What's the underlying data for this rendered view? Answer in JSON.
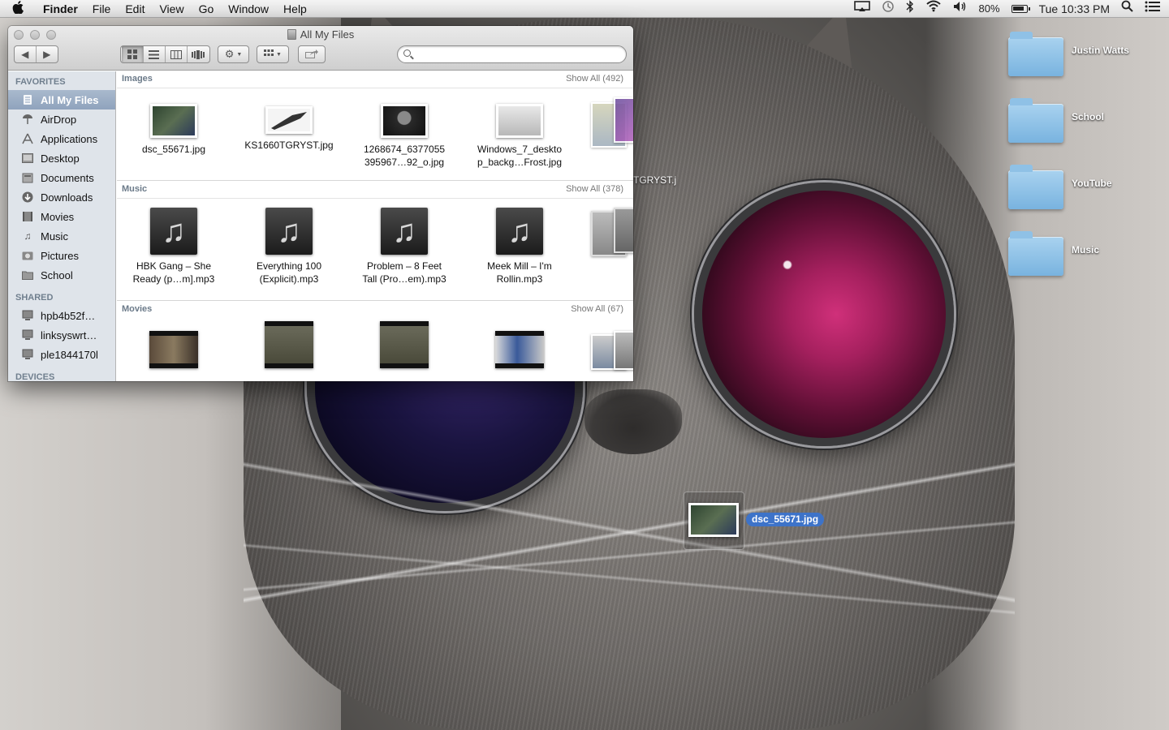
{
  "menubar": {
    "app_name": "Finder",
    "menus": [
      "File",
      "Edit",
      "View",
      "Go",
      "Window",
      "Help"
    ],
    "battery_percent": "80%",
    "clock": "Tue 10:33 PM",
    "status_icons": [
      "airplay-icon",
      "time-machine-icon",
      "bluetooth-icon",
      "wifi-icon",
      "volume-icon",
      "battery-icon",
      "spotlight-icon",
      "notification-center-icon"
    ]
  },
  "window": {
    "title": "All My Files"
  },
  "sidebar": {
    "favorites_header": "FAVORITES",
    "favorites": [
      {
        "label": "All My Files",
        "icon": "all-my-files-icon",
        "selected": true
      },
      {
        "label": "AirDrop",
        "icon": "airdrop-icon"
      },
      {
        "label": "Applications",
        "icon": "applications-icon"
      },
      {
        "label": "Desktop",
        "icon": "desktop-icon"
      },
      {
        "label": "Documents",
        "icon": "documents-icon"
      },
      {
        "label": "Downloads",
        "icon": "downloads-icon"
      },
      {
        "label": "Movies",
        "icon": "movies-icon"
      },
      {
        "label": "Music",
        "icon": "music-icon"
      },
      {
        "label": "Pictures",
        "icon": "pictures-icon"
      },
      {
        "label": "School",
        "icon": "folder-icon"
      }
    ],
    "shared_header": "SHARED",
    "shared": [
      {
        "label": "hpb4b52f…",
        "icon": "network-computer-icon"
      },
      {
        "label": "linksyswrt…",
        "icon": "network-computer-icon"
      },
      {
        "label": "ple1844170l",
        "icon": "network-computer-icon"
      }
    ],
    "devices_header": "DEVICES"
  },
  "sections": {
    "images": {
      "title": "Images",
      "show_all": "Show All (492)",
      "files": [
        {
          "name_line1": "dsc_55671.jpg",
          "name_line2": ""
        },
        {
          "name_line1": "KS1660TGRYST.jpg",
          "name_line2": ""
        },
        {
          "name_line1": "1268674_6377055",
          "name_line2": "395967…92_o.jpg"
        },
        {
          "name_line1": "Windows_7_deskto",
          "name_line2": "p_backg…Frost.jpg"
        }
      ]
    },
    "music": {
      "title": "Music",
      "show_all": "Show All (378)",
      "files": [
        {
          "name_line1": "HBK Gang – She",
          "name_line2": "Ready (p…m].mp3"
        },
        {
          "name_line1": "Everything 100",
          "name_line2": "(Explicit).mp3"
        },
        {
          "name_line1": "Problem – 8 Feet",
          "name_line2": "Tall (Pro…em).mp3"
        },
        {
          "name_line1": "Meek Mill – I'm",
          "name_line2": "Rollin.mp3"
        }
      ]
    },
    "movies": {
      "title": "Movies",
      "show_all": "Show All (67)"
    }
  },
  "desktop": {
    "icons": [
      {
        "label": "Justin Watts"
      },
      {
        "label": "School"
      },
      {
        "label": "YouTube"
      },
      {
        "label": "Music"
      }
    ],
    "dragged_file": "dsc_55671.jpg",
    "partial_label": "TGRYST.j"
  }
}
